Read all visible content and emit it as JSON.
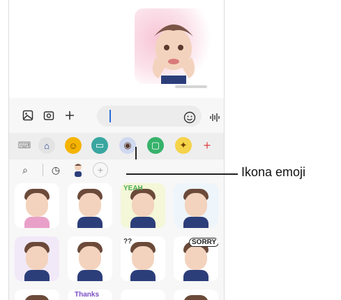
{
  "input": {
    "placeholder": ""
  },
  "tabs": [
    {
      "name": "keyboard",
      "glyph": "⌨"
    },
    {
      "name": "home",
      "glyph": "⌂"
    },
    {
      "name": "emoji",
      "glyph": "☺"
    },
    {
      "name": "gif",
      "glyph": "▭"
    },
    {
      "name": "ar-emoji",
      "glyph": "◉"
    },
    {
      "name": "bitmoji",
      "glyph": "▢"
    },
    {
      "name": "sticker-pack",
      "glyph": "✦"
    },
    {
      "name": "add",
      "glyph": "+"
    }
  ],
  "sub_row": {
    "search": "⌕",
    "recent": "◷",
    "add": "+"
  },
  "stickers": [
    {
      "text": ""
    },
    {
      "text": ""
    },
    {
      "text": "YEAH"
    },
    {
      "text": ""
    },
    {
      "text": ""
    },
    {
      "text": ""
    },
    {
      "text": "??"
    },
    {
      "text": "SORRY"
    },
    {
      "text": ""
    },
    {
      "text": "Thanks"
    },
    {
      "text": ""
    },
    {
      "text": ""
    }
  ],
  "callout": {
    "label": "Ikona emoji"
  },
  "colors": {
    "accent": "#2a6ad8",
    "add_red": "#e0464a",
    "active_tab": "#cfd9f0"
  }
}
